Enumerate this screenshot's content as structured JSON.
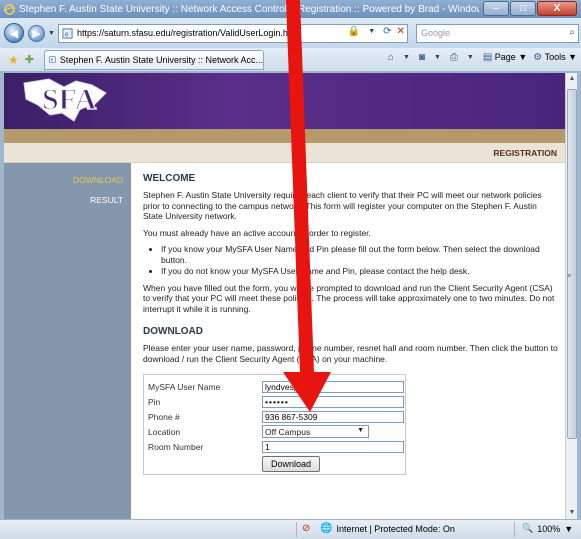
{
  "window": {
    "title": "Stephen F. Austin State University :: Network Access Control :: Registration :: Powered by Brad - Windows Internet Explorer",
    "minimize": "–",
    "maximize": "□",
    "close": "X"
  },
  "addressbar": {
    "url": "https://saturn.sfasu.edu/registration/ValidUserLogin.ht",
    "search_placeholder": "Google"
  },
  "tab": {
    "label": "Stephen F. Austin State University :: Network Acc..."
  },
  "toolbar": {
    "page_label": "Page",
    "tools_label": "Tools"
  },
  "header": {
    "registration_label": "REGISTRATION",
    "logo_text": "SFA"
  },
  "sidenav": {
    "items": [
      {
        "label": "DOWNLOAD",
        "active": true
      },
      {
        "label": "RESULT",
        "active": false
      }
    ]
  },
  "content": {
    "welcome_heading": "WELCOME",
    "welcome_p1": "Stephen F. Austin State University requires each client to verify that their PC will meet our network policies prior to connecting to the campus network. This form will register your computer on the Stephen F. Austin State University network.",
    "welcome_p2": "You must already have an active account in order to register.",
    "bullets": [
      "If you know your MySFA User Name and Pin please fill out the form below. Then select the download button.",
      "If you do not know your MySFA User Name and Pin, please contact the help desk."
    ],
    "welcome_p3": "When you have filled out the form, you will be prompted to download and run the Client Security Agent (CSA) to verify that your PC will meet these policies. The process will take approximately one to two minutes. Do not interrupt it while it is running.",
    "download_heading": "DOWNLOAD",
    "download_p": "Please enter your user name, password, phone number, resnet hall and room number. Then click the button to download / run the Client Security Agent (CSA) on your machine."
  },
  "form": {
    "username_label": "MySFA User Name",
    "username_value": "lyndvesper",
    "pin_label": "Pin",
    "pin_value": "••••••",
    "phone_label": "Phone #",
    "phone_value": "936 867-5309",
    "location_label": "Location",
    "location_value": "Off Campus",
    "room_label": "Room Number",
    "room_value": "1",
    "download_button": "Download"
  },
  "statusbar": {
    "zone": "Internet | Protected Mode: On",
    "zoom": "100%"
  },
  "colors": {
    "banner_purple": "#4a247a",
    "gold": "#b49a6a",
    "sidenav": "#8497ad",
    "active_nav": "#e6c65a",
    "arrow_red": "#e8140f"
  }
}
